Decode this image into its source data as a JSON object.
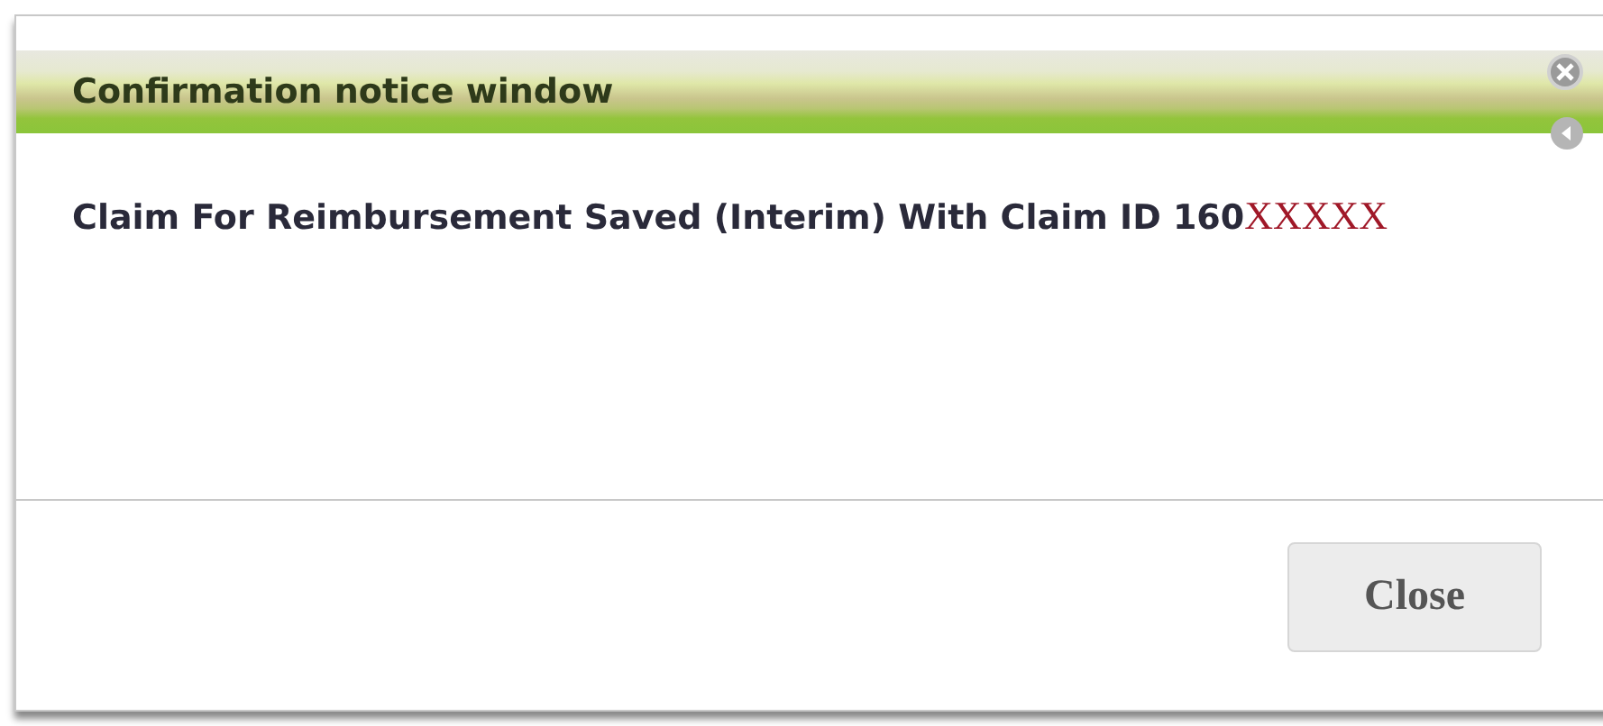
{
  "window": {
    "title": "Confirmation notice window"
  },
  "message": {
    "text": "Claim For Reimbursement Saved (Interim) With Claim ID 160",
    "redacted": "XXXXX"
  },
  "buttons": [
    "Close"
  ]
}
